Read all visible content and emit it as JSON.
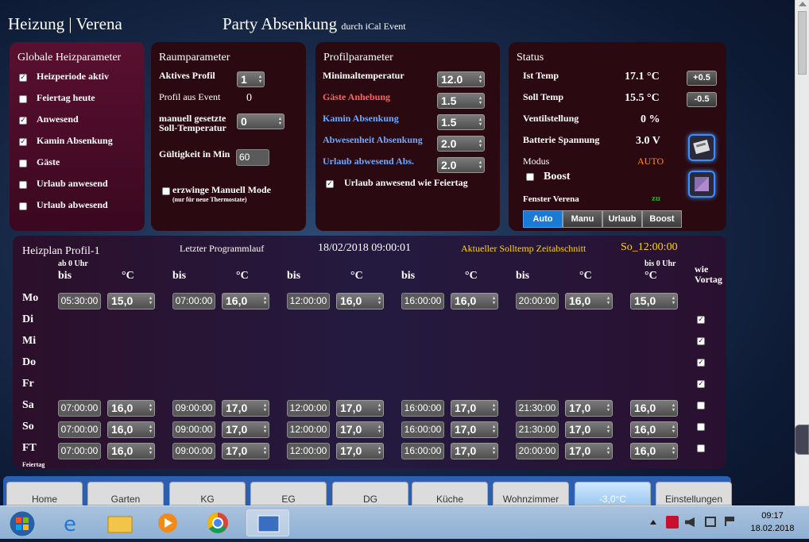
{
  "header": {
    "title": "Heizung | Verena",
    "party": "Party Absenkung",
    "party_sub": "durch iCal Event"
  },
  "global": {
    "title": "Globale Heizparameter",
    "items": [
      {
        "label": "Heizperiode aktiv",
        "checked": true
      },
      {
        "label": "Feiertag heute",
        "checked": false
      },
      {
        "label": "Anwesend",
        "checked": true
      },
      {
        "label": "Kamin Absenkung",
        "checked": true
      },
      {
        "label": "Gäste",
        "checked": false
      },
      {
        "label": "Urlaub anwesend",
        "checked": false
      },
      {
        "label": "Urlaub abwesend",
        "checked": false
      }
    ]
  },
  "room": {
    "title": "Raumparameter",
    "active_profile_label": "Aktives Profil",
    "active_profile_value": "1",
    "event_profile_label": "Profil aus Event",
    "event_profile_value": "0",
    "manual_label1": "manuell gesetzte",
    "manual_label2": "Soll-Temperatur",
    "manual_value": "0",
    "validity_label": "Gültigkeit in Min",
    "validity_value": "60",
    "force_label": "erzwinge Manuell Mode",
    "force_sub": "(nur für neue Thermostate)"
  },
  "profile": {
    "title": "Profilparameter",
    "items": [
      {
        "label": "Minimaltemperatur",
        "value": "12.0",
        "color": "#ffffff"
      },
      {
        "label": "Gäste Anhebung",
        "value": "1.5",
        "color": "#ff6060"
      },
      {
        "label": "Kamin Absenkung",
        "value": "1.5",
        "color": "#6fa8ff"
      },
      {
        "label": "Abwesenheit Absenkung",
        "value": "2.0",
        "color": "#6fa8ff"
      },
      {
        "label": "Urlaub abwesend Abs.",
        "value": "2.0",
        "color": "#6fa8ff"
      }
    ],
    "holiday_label": "Urlaub anwesend wie Feiertag"
  },
  "status": {
    "title": "Status",
    "ist_label": "Ist Temp",
    "ist_value": "17.1 °C",
    "plus": "+0.5",
    "soll_label": "Soll Temp",
    "soll_value": "15.5 °C",
    "minus": "-0.5",
    "ventil_label": "Ventilstellung",
    "ventil_value": "0 %",
    "batt_label": "Batterie Spannung",
    "batt_value": "3.0 V",
    "modus_label": "Modus",
    "modus_value": "AUTO",
    "boost_label": "Boost",
    "fenster_label": "Fenster Verena",
    "fenster_value": "zu",
    "modes": [
      "Auto",
      "Manu",
      "Urlaub",
      "Boost"
    ]
  },
  "plan": {
    "title": "Heizplan Profil-1",
    "last_run_label": "Letzter Programmlauf",
    "last_run_value": "18/02/2018 09:00:01",
    "current_label": "Aktueller Solltemp Zeitabschnitt",
    "current_value": "So_12:00:00",
    "ab0": "ab 0 Uhr",
    "bis0": "bis 0 Uhr",
    "bis": "bis",
    "degc": "°C",
    "wie": "wie",
    "vortag": "Vortag",
    "days": [
      {
        "day": "Mo",
        "slots": [
          [
            "05:30:00",
            "15,0"
          ],
          [
            "07:00:00",
            "16,0"
          ],
          [
            "12:00:00",
            "16,0"
          ],
          [
            "16:00:00",
            "16,0"
          ],
          [
            "20:00:00",
            "16,0"
          ]
        ],
        "last": "15,0",
        "prev": null
      },
      {
        "day": "Di",
        "slots": null,
        "prev": true
      },
      {
        "day": "Mi",
        "slots": null,
        "prev": true
      },
      {
        "day": "Do",
        "slots": null,
        "prev": true
      },
      {
        "day": "Fr",
        "slots": null,
        "prev": true
      },
      {
        "day": "Sa",
        "slots": [
          [
            "07:00:00",
            "16,0"
          ],
          [
            "09:00:00",
            "17,0"
          ],
          [
            "12:00:00",
            "17,0"
          ],
          [
            "16:00:00",
            "17,0"
          ],
          [
            "21:30:00",
            "17,0"
          ]
        ],
        "last": "16,0",
        "prev": false
      },
      {
        "day": "So",
        "slots": [
          [
            "07:00:00",
            "16,0"
          ],
          [
            "09:00:00",
            "17,0"
          ],
          [
            "12:00:00",
            "17,0"
          ],
          [
            "16:00:00",
            "17,0"
          ],
          [
            "21:30:00",
            "17,0"
          ]
        ],
        "last": "16,0",
        "prev": false
      },
      {
        "day": "FT",
        "slots": [
          [
            "07:00:00",
            "16,0"
          ],
          [
            "09:00:00",
            "17,0"
          ],
          [
            "12:00:00",
            "17,0"
          ],
          [
            "16:00:00",
            "17,0"
          ],
          [
            "20:00:00",
            "17,0"
          ]
        ],
        "last": "16,0",
        "prev": false
      }
    ],
    "ft_sub": "Feiertag"
  },
  "tabs": [
    "Home",
    "Garten",
    "KG",
    "EG",
    "DG",
    "Küche",
    "Wohnzimmer",
    "-3,0°C",
    "Einstellungen"
  ],
  "taskbar": {
    "time": "09:17",
    "date": "18.02.2018"
  }
}
